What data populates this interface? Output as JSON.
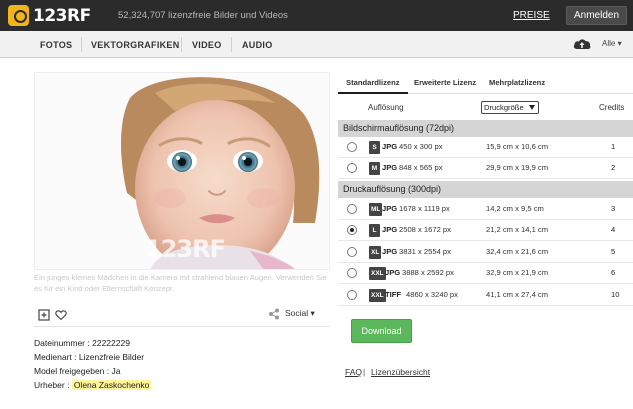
{
  "header": {
    "logo_text": "123RF",
    "tagline": "52,324,707 lizenzfreie Bilder und Videos",
    "preise_label": "PREISE",
    "login_label": "Anmelden"
  },
  "nav": {
    "items": [
      "FOTOS",
      "VEKTORGRAFIKEN",
      "VIDEO",
      "AUDIO"
    ],
    "filter_label": "Alle"
  },
  "image": {
    "watermark": "123RF",
    "caption": "Ein junges kleines Mädchen in die Kamera mit strahlend blauen Augen. Verwenden Sie es für ein Kind oder Elternschaft Konzept.",
    "social_label": "Social"
  },
  "meta": {
    "lines": [
      {
        "label": "Dateinummer :",
        "value": "22222229"
      },
      {
        "label": "Medienart :",
        "value": "Lizenzfreie Bilder"
      },
      {
        "label": "Model freigegeben :",
        "value": "Ja"
      },
      {
        "label": "Urheber :",
        "value": "Olena Zaskochenko"
      }
    ]
  },
  "license": {
    "tabs": [
      "Standardlizenz",
      "Erweiterte Lizenz",
      "Mehrplatzlizenz"
    ],
    "col_resolution": "Auflösung",
    "print_select": "Druckgröße",
    "col_credits": "Credits",
    "section_screen": "Bildschirmauflösung (72dpi)",
    "section_print": "Druckauflösung (300dpi)",
    "rows": [
      {
        "size": "S",
        "fmt": "JPG",
        "px": "450 x 300 px",
        "cm": "15,9 cm x 10,6 cm",
        "credits": "1",
        "selected": false
      },
      {
        "size": "M",
        "fmt": "JPG",
        "px": "848 x 565 px",
        "cm": "29,9 cm x 19,9 cm",
        "credits": "2",
        "selected": false
      },
      {
        "size": "ML",
        "fmt": "JPG",
        "px": "1678 x 1119 px",
        "cm": "14,2 cm x 9,5 cm",
        "credits": "3",
        "selected": false
      },
      {
        "size": "L",
        "fmt": "JPG",
        "px": "2508 x 1672 px",
        "cm": "21,2 cm x 14,1 cm",
        "credits": "4",
        "selected": true
      },
      {
        "size": "XL",
        "fmt": "JPG",
        "px": "3831 x 2554 px",
        "cm": "32,4 cm x 21,6 cm",
        "credits": "5",
        "selected": false
      },
      {
        "size": "XXL",
        "fmt": "JPG",
        "px": "3888 x 2592 px",
        "cm": "32,9 cm x 21,9 cm",
        "credits": "6",
        "selected": false
      },
      {
        "size": "XXL",
        "fmt": "TIFF",
        "px": "4860 x 3240 px",
        "cm": "41,1 cm x 27,4 cm",
        "credits": "10",
        "selected": false
      }
    ],
    "download_label": "Download",
    "faq_label": "FAQ",
    "separator": "|",
    "overview_label": "Lizenzübersicht"
  },
  "colors": {
    "topbar": "#2b2b2b",
    "logo_accent": "#f2b41b",
    "download": "#5cb85c",
    "highlight": "#fff59a"
  }
}
